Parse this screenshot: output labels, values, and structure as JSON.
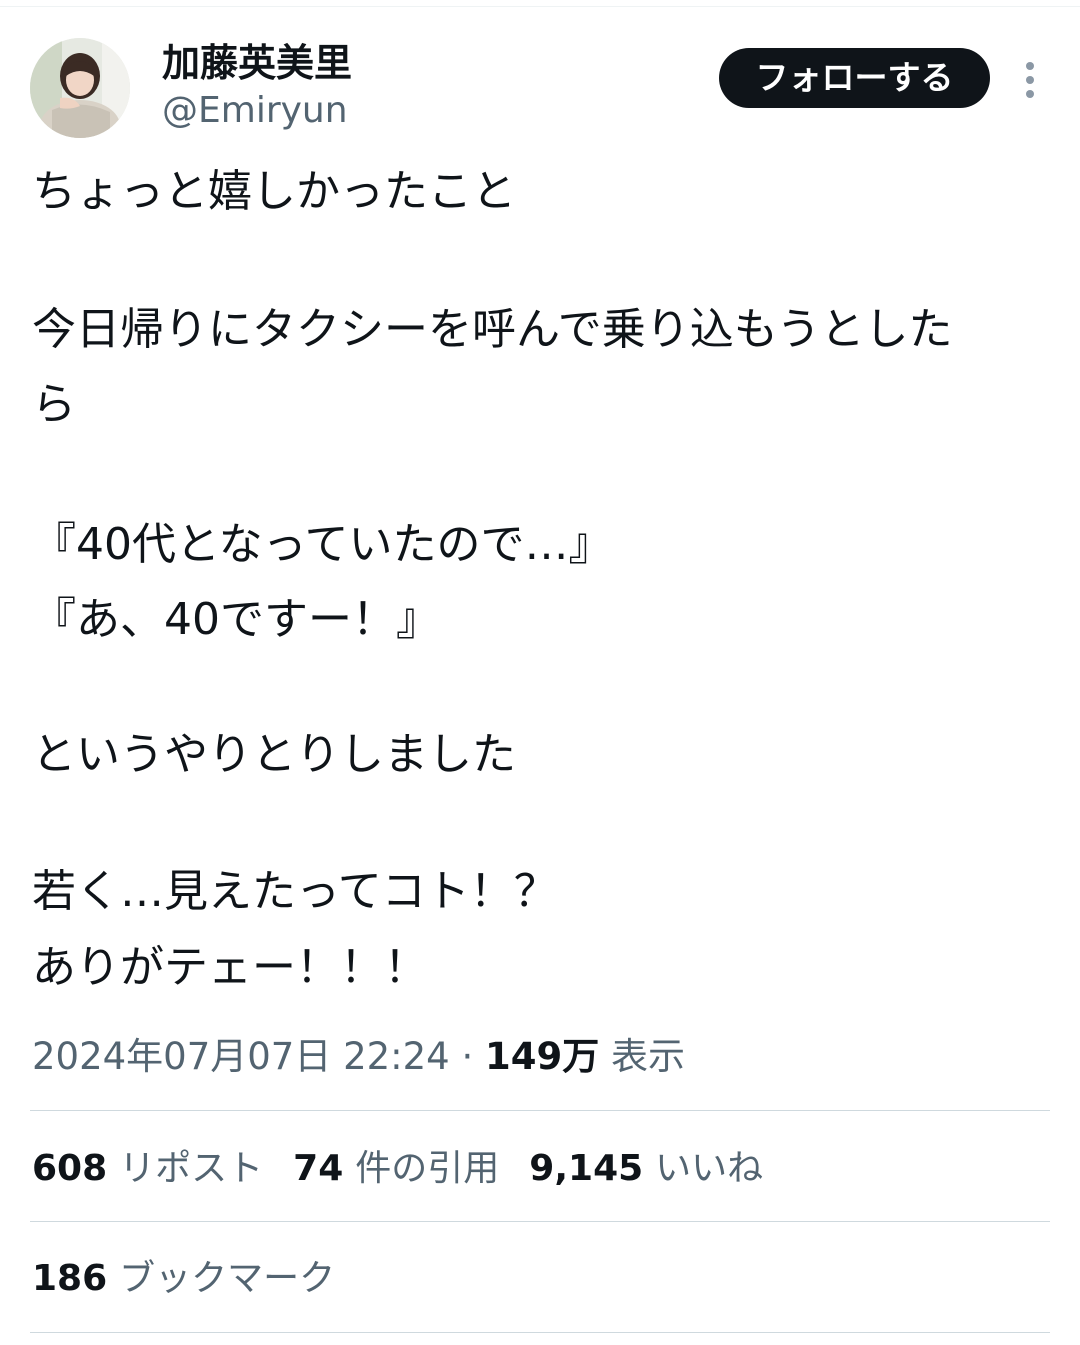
{
  "author": {
    "name": "加藤英美里",
    "handle": "@Emiryun"
  },
  "header": {
    "follow_label": "フォローする",
    "more_icon": "more-vertical-icon"
  },
  "tweet": {
    "lines": [
      "ちょっと嬉しかったこと",
      "今日帰りにタクシーを呼んで乗り込もうとした",
      "ら",
      "『40代となっていたので…』",
      "『あ、40ですー！』",
      "というやりとりしました",
      "若く…見えたってコト！？",
      "ありがテェー！！！"
    ]
  },
  "meta": {
    "timestamp": "2024年07月07日 22:24",
    "separator": " · ",
    "views_count": "149万",
    "views_label": " 表示"
  },
  "stats": {
    "reposts": {
      "count": "608",
      "label": "リポスト"
    },
    "quotes": {
      "count": "74",
      "label": "件の引用"
    },
    "likes": {
      "count": "9,145",
      "label": "いいね"
    },
    "bookmarks": {
      "count": "186",
      "label": "ブックマーク"
    }
  },
  "colors": {
    "text_primary": "#0f1419",
    "text_secondary": "#536471",
    "divider": "#cfd9de",
    "button_bg": "#0f1419",
    "button_text": "#ffffff"
  }
}
